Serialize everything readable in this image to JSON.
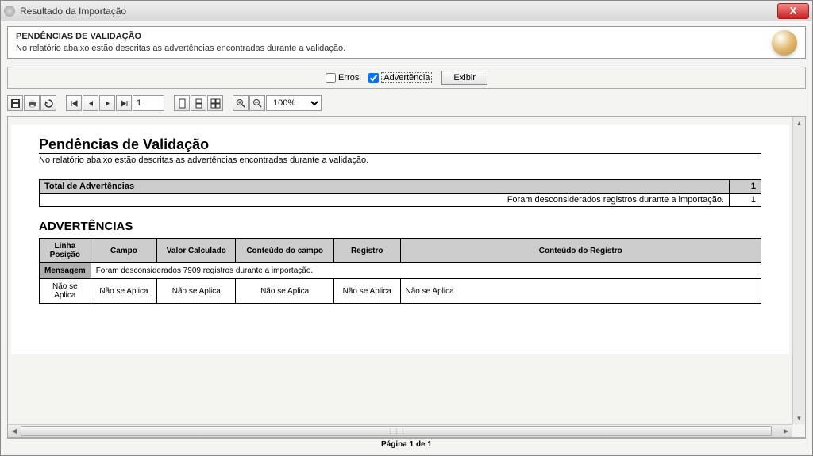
{
  "window": {
    "title": "Resultado da Importação",
    "close": "X"
  },
  "header": {
    "title": "PENDÊNCIAS DE VALIDAÇÃO",
    "subtitle": "No relatório abaixo estão descritas as advertências encontradas durante a validação."
  },
  "filter": {
    "errors_label": "Erros",
    "warnings_label": "Advertência",
    "show_button": "Exibir",
    "errors_checked": false,
    "warnings_checked": true
  },
  "toolbar": {
    "page_value": "1",
    "zoom_value": "100%"
  },
  "report": {
    "title": "Pendências de Validação",
    "subtitle": "No relatório abaixo estão descritas as advertências encontradas durante a validação.",
    "summary": {
      "total_label": "Total de Advertências",
      "total_value": "1",
      "note_label": "Foram desconsiderados registros durante a importação.",
      "note_value": "1"
    },
    "section_title": "ADVERTÊNCIAS",
    "columns": {
      "linha": "Linha Posição",
      "campo": "Campo",
      "valor": "Valor Calculado",
      "conteudo_campo": "Conteúdo do campo",
      "registro": "Registro",
      "conteudo_registro": "Conteúdo do Registro"
    },
    "message_row": {
      "label": "Mensagem",
      "content": "Foram desconsiderados 7909 registros durante a importação."
    },
    "data_row": {
      "c1": "Não se Aplica",
      "c2": "Não se Aplica",
      "c3": "Não se Aplica",
      "c4": "Não se Aplica",
      "c5": "Não se Aplica",
      "c6": "Não se Aplica"
    }
  },
  "footer": {
    "page_text": "Página 1 de 1"
  }
}
